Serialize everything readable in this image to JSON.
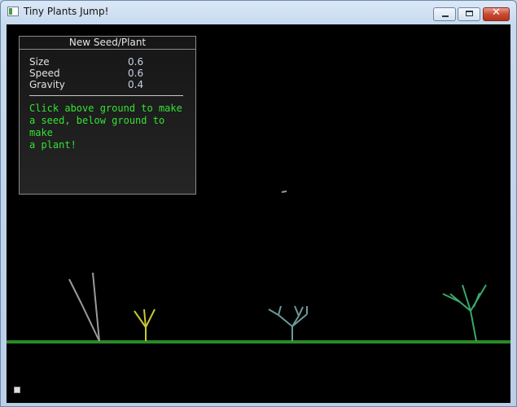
{
  "window": {
    "title": "Tiny Plants Jump!",
    "close_glyph": "✕"
  },
  "panel": {
    "title": "New Seed/Plant",
    "params": [
      {
        "label": "Size",
        "value": "0.6"
      },
      {
        "label": "Speed",
        "value": "0.6"
      },
      {
        "label": "Gravity",
        "value": "0.4"
      }
    ],
    "help": "Click above ground to make\na seed, below ground to make\na plant!"
  },
  "colors": {
    "background": "#000000",
    "ground": "#2a8a2a",
    "help_text": "#33e233",
    "plant_grey": "#9a9a9a",
    "plant_yellow": "#c8c832",
    "plant_teal": "#6a9a9a",
    "plant_green": "#3aaa6a"
  },
  "icons": {
    "app": "app-window-icon",
    "corner": "help-icon"
  }
}
